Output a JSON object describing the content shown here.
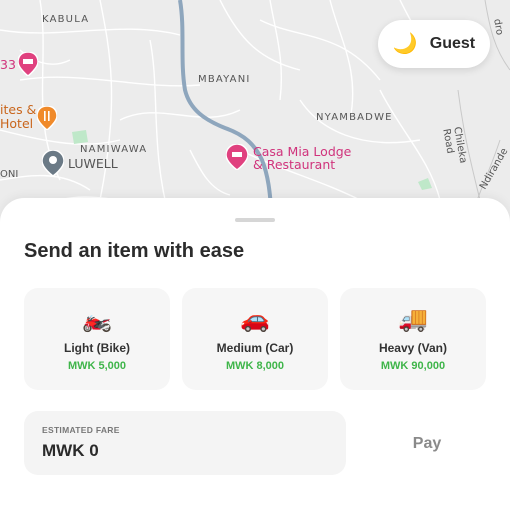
{
  "map": {
    "areas": [
      "KABULA",
      "MBAYANI",
      "NYAMBADWE",
      "NAMIWAWA"
    ],
    "places": {
      "left_partial": "33",
      "hotel_line1": "ites &",
      "hotel_line2": "Hotel",
      "luwell": "LUWELL",
      "oni": "ONI",
      "casa_line1": "Casa Mia Lodge",
      "casa_line2": "& Restaurant"
    },
    "streets": [
      "Chileka Road",
      "Ndirande",
      "dro"
    ],
    "colors": {
      "road": "#9fb3c6",
      "lodging": "#e0417f",
      "food": "#f08a2a",
      "park": "#bfe8c9"
    }
  },
  "header": {
    "theme_icon": "moon-icon",
    "theme_emoji": "🌙",
    "user_label": "Guest"
  },
  "sheet": {
    "title": "Send an item with ease",
    "vehicles": [
      {
        "icon": "motorbike-icon",
        "emoji": "🏍️",
        "name": "Light (Bike)",
        "price": "MWK 5,000"
      },
      {
        "icon": "car-icon",
        "emoji": "🚗",
        "name": "Medium (Car)",
        "price": "MWK 8,000"
      },
      {
        "icon": "truck-icon",
        "emoji": "🚚",
        "name": "Heavy (Van)",
        "price": "MWK 90,000"
      }
    ],
    "fare": {
      "label": "ESTIMATED FARE",
      "value": "MWK 0"
    },
    "pay_label": "Pay"
  },
  "colors": {
    "accent_green": "#3fb54a",
    "card_bg": "#f6f6f6"
  }
}
